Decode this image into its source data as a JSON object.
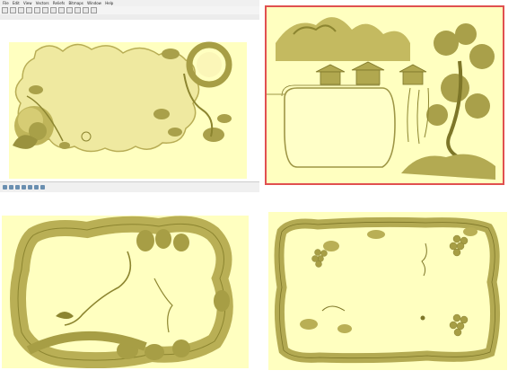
{
  "menu": [
    "File",
    "Edit",
    "View",
    "Vectors",
    "Reliefs",
    "Bitmaps",
    "Window",
    "Help"
  ],
  "colors": {
    "relief_bg": "#ffffc0",
    "relief_gold": "#c9c068",
    "relief_shadow": "#8c8530",
    "selection_border": "#e05050"
  },
  "toolbar_icons": [
    "new-icon",
    "open-icon",
    "save-icon",
    "undo-icon",
    "redo-icon",
    "zoom-icon",
    "select-icon",
    "node-icon",
    "transform-icon",
    "align-icon",
    "group-icon",
    "measure-icon"
  ],
  "status_icons": [
    "view-2d-icon",
    "view-3d-icon",
    "shade-icon",
    "light-icon",
    "grid-icon",
    "snap-icon",
    "layer-icon"
  ],
  "panels": [
    {
      "id": "top-left",
      "subject": "peony-and-vine-frame"
    },
    {
      "id": "top-right",
      "subject": "pagoda-landscape-frame"
    },
    {
      "id": "bottom-left",
      "subject": "fruit-and-vine-frame"
    },
    {
      "id": "bottom-right",
      "subject": "bamboo-grape-frame"
    }
  ]
}
